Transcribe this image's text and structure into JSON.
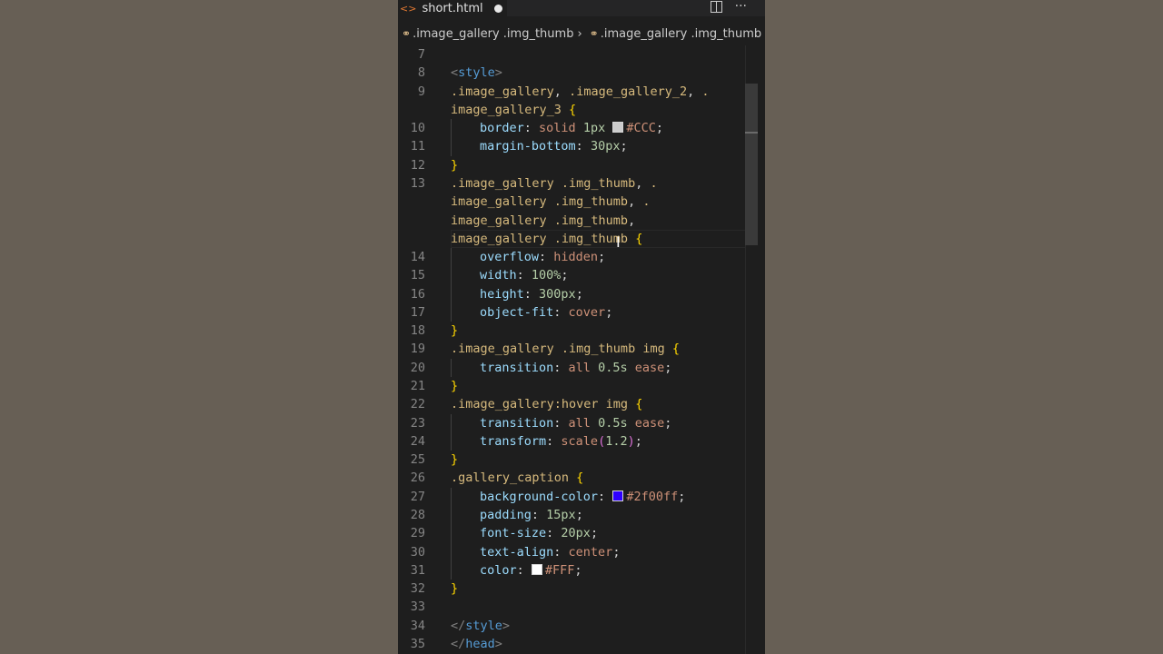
{
  "tab": {
    "filename": "short.html",
    "icon": "html-file-icon"
  },
  "breadcrumb": [
    ".image_gallery .img_thumb",
    ".image_gallery .img_thumb"
  ],
  "lines": [
    {
      "n": "7",
      "parts": []
    },
    {
      "n": "8",
      "parts": [
        [
          "tag",
          "<"
        ],
        [
          "tagname",
          "style"
        ],
        [
          "tag",
          ">"
        ]
      ]
    },
    {
      "n": "9",
      "parts": [
        [
          "sel",
          ".image_gallery"
        ],
        [
          "punct",
          ", "
        ],
        [
          "sel",
          ".image_gallery_2"
        ],
        [
          "punct",
          ", "
        ],
        [
          "sel",
          "."
        ]
      ]
    },
    {
      "n": "",
      "parts": [
        [
          "sel",
          "image_gallery_3 "
        ],
        [
          "brace",
          "{"
        ]
      ]
    },
    {
      "n": "10",
      "indent": true,
      "parts": [
        [
          "prop",
          "border"
        ],
        [
          "punct",
          ": "
        ],
        [
          "val",
          "solid "
        ],
        [
          "num",
          "1px "
        ],
        [
          "swatch",
          "#CCC"
        ],
        [
          "val",
          "#CCC"
        ],
        [
          "punct",
          ";"
        ]
      ]
    },
    {
      "n": "11",
      "indent": true,
      "parts": [
        [
          "prop",
          "margin-bottom"
        ],
        [
          "punct",
          ": "
        ],
        [
          "num",
          "30px"
        ],
        [
          "punct",
          ";"
        ]
      ]
    },
    {
      "n": "12",
      "parts": [
        [
          "brace",
          "}"
        ]
      ]
    },
    {
      "n": "13",
      "parts": [
        [
          "sel",
          ".image_gallery .img_thumb"
        ],
        [
          "punct",
          ", "
        ],
        [
          "sel",
          "."
        ]
      ]
    },
    {
      "n": "",
      "parts": [
        [
          "sel",
          "image_gallery .img_thumb"
        ],
        [
          "punct",
          ", "
        ],
        [
          "sel",
          "."
        ]
      ]
    },
    {
      "n": "",
      "parts": [
        [
          "sel",
          "image_gallery .img_thumb"
        ],
        [
          "punct",
          ","
        ]
      ]
    },
    {
      "n": "",
      "parts": [
        [
          "sel",
          "image_gallery .img_thumb "
        ],
        [
          "brace",
          "{"
        ]
      ]
    },
    {
      "n": "14",
      "indent": true,
      "parts": [
        [
          "prop",
          "overflow"
        ],
        [
          "punct",
          ": "
        ],
        [
          "val",
          "hidden"
        ],
        [
          "punct",
          ";"
        ]
      ]
    },
    {
      "n": "15",
      "indent": true,
      "parts": [
        [
          "prop",
          "width"
        ],
        [
          "punct",
          ": "
        ],
        [
          "num",
          "100%"
        ],
        [
          "punct",
          ";"
        ]
      ]
    },
    {
      "n": "16",
      "indent": true,
      "parts": [
        [
          "prop",
          "height"
        ],
        [
          "punct",
          ": "
        ],
        [
          "num",
          "300px"
        ],
        [
          "punct",
          ";"
        ]
      ]
    },
    {
      "n": "17",
      "indent": true,
      "parts": [
        [
          "prop",
          "object-fit"
        ],
        [
          "punct",
          ": "
        ],
        [
          "val",
          "cover"
        ],
        [
          "punct",
          ";"
        ]
      ]
    },
    {
      "n": "18",
      "parts": [
        [
          "brace",
          "}"
        ]
      ]
    },
    {
      "n": "19",
      "parts": [
        [
          "sel",
          ".image_gallery .img_thumb img "
        ],
        [
          "brace",
          "{"
        ]
      ]
    },
    {
      "n": "20",
      "indent": true,
      "parts": [
        [
          "prop",
          "transition"
        ],
        [
          "punct",
          ": "
        ],
        [
          "val",
          "all "
        ],
        [
          "num",
          "0.5s "
        ],
        [
          "val",
          "ease"
        ],
        [
          "punct",
          ";"
        ]
      ]
    },
    {
      "n": "21",
      "parts": [
        [
          "brace",
          "}"
        ]
      ]
    },
    {
      "n": "22",
      "parts": [
        [
          "sel",
          ".image_gallery:hover img "
        ],
        [
          "brace",
          "{"
        ]
      ]
    },
    {
      "n": "23",
      "indent": true,
      "parts": [
        [
          "prop",
          "transition"
        ],
        [
          "punct",
          ": "
        ],
        [
          "val",
          "all "
        ],
        [
          "num",
          "0.5s "
        ],
        [
          "val",
          "ease"
        ],
        [
          "punct",
          ";"
        ]
      ]
    },
    {
      "n": "24",
      "indent": true,
      "parts": [
        [
          "prop",
          "transform"
        ],
        [
          "punct",
          ": "
        ],
        [
          "val",
          "scale"
        ],
        [
          "paren",
          "("
        ],
        [
          "num",
          "1.2"
        ],
        [
          "paren",
          ")"
        ],
        [
          "punct",
          ";"
        ]
      ]
    },
    {
      "n": "25",
      "parts": [
        [
          "brace",
          "}"
        ]
      ]
    },
    {
      "n": "26",
      "parts": [
        [
          "sel",
          ".gallery_caption "
        ],
        [
          "brace",
          "{"
        ]
      ]
    },
    {
      "n": "27",
      "indent": true,
      "parts": [
        [
          "prop",
          "background-color"
        ],
        [
          "punct",
          ": "
        ],
        [
          "swatch",
          "#2f00ff"
        ],
        [
          "val",
          "#2f00ff"
        ],
        [
          "punct",
          ";"
        ]
      ]
    },
    {
      "n": "28",
      "indent": true,
      "parts": [
        [
          "prop",
          "padding"
        ],
        [
          "punct",
          ": "
        ],
        [
          "num",
          "15px"
        ],
        [
          "punct",
          ";"
        ]
      ]
    },
    {
      "n": "29",
      "indent": true,
      "parts": [
        [
          "prop",
          "font-size"
        ],
        [
          "punct",
          ": "
        ],
        [
          "num",
          "20px"
        ],
        [
          "punct",
          ";"
        ]
      ]
    },
    {
      "n": "30",
      "indent": true,
      "parts": [
        [
          "prop",
          "text-align"
        ],
        [
          "punct",
          ": "
        ],
        [
          "val",
          "center"
        ],
        [
          "punct",
          ";"
        ]
      ]
    },
    {
      "n": "31",
      "indent": true,
      "parts": [
        [
          "prop",
          "color"
        ],
        [
          "punct",
          ": "
        ],
        [
          "swatch",
          "#FFF"
        ],
        [
          "val",
          "#FFF"
        ],
        [
          "punct",
          ";"
        ]
      ]
    },
    {
      "n": "32",
      "parts": [
        [
          "brace",
          "}"
        ]
      ]
    },
    {
      "n": "33",
      "parts": []
    },
    {
      "n": "34",
      "parts": [
        [
          "tag",
          "</"
        ],
        [
          "tagname",
          "style"
        ],
        [
          "tag",
          ">"
        ]
      ]
    },
    {
      "n": "35",
      "parts": [
        [
          "tag",
          "</"
        ],
        [
          "tagname",
          "head"
        ],
        [
          "tag",
          ">"
        ]
      ]
    }
  ],
  "colors": {
    "editor_bg": "#1e1e1e",
    "selector": "#d7ba7d",
    "property": "#9cdcfe",
    "value": "#ce9178",
    "number": "#b5cea8"
  }
}
